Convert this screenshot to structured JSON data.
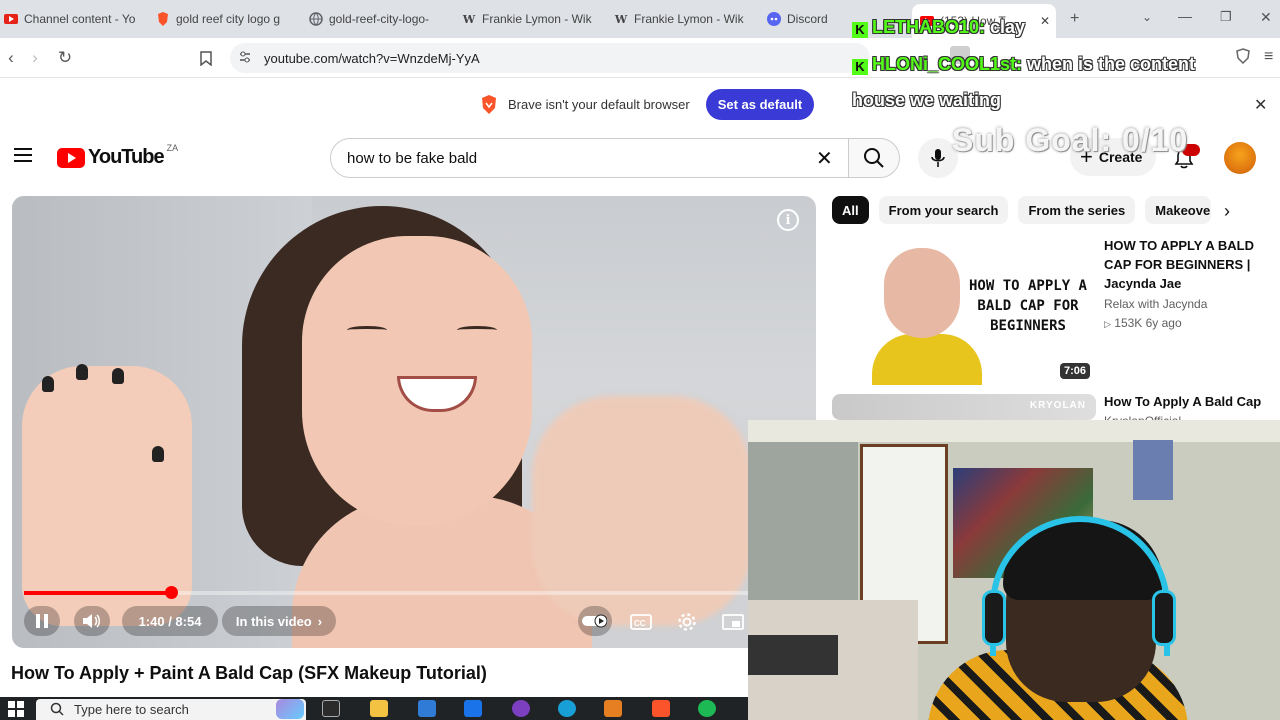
{
  "browser": {
    "tabs": [
      {
        "label": "Channel content - Yo",
        "icon": "youtube-studio-icon",
        "color": "#e62117"
      },
      {
        "label": "gold reef city logo g",
        "icon": "brave-icon",
        "color": "#fb542b"
      },
      {
        "label": "gold-reef-city-logo-",
        "icon": "globe-icon",
        "color": "#5f6368"
      },
      {
        "label": "Frankie Lymon - Wik",
        "icon": "wikipedia-icon",
        "color": "#202124"
      },
      {
        "label": "Frankie Lymon - Wik",
        "icon": "wikipedia-icon",
        "color": "#202124"
      },
      {
        "label": "Discord",
        "icon": "discord-icon",
        "color": "#5865f2"
      },
      {
        "label": "(153) How T",
        "icon": "youtube-icon",
        "color": "#ff0000"
      }
    ],
    "url": "youtube.com/watch?v=WnzdeMj-YyA",
    "banner_text": "Brave isn't your default browser",
    "banner_button": "Set as default"
  },
  "youtube": {
    "logo_text": "YouTube",
    "country": "ZA",
    "search_value": "how to be fake bald",
    "create_label": "Create",
    "player": {
      "time": "1:40 / 8:54",
      "progress_fraction": 0.188,
      "chapters_label": "In this video"
    },
    "video_title": "How To Apply + Paint A Bald Cap (SFX Makeup Tutorial)",
    "chips": [
      "All",
      "From your search",
      "From the series",
      "Makeove"
    ],
    "suggestions": [
      {
        "title": "HOW TO APPLY A BALD CAP FOR BEGINNERS | Jacynda Jae",
        "channel": "Relax with Jacynda",
        "stats": "153K   6y ago",
        "duration": "7:06",
        "thumb_text": "HOW TO APPLY A BALD CAP FOR BEGINNERS"
      },
      {
        "title": "How To Apply A Bald Cap",
        "channel": "KryolanOfficial",
        "thumb_text": "KRYOLAN"
      }
    ]
  },
  "stream_overlay": {
    "chat": [
      {
        "user": "LETHABO10:",
        "message": "clay"
      },
      {
        "user": "HLONi_COOL1st:",
        "message": "when is the content"
      },
      {
        "user": "",
        "message": "house we waiting"
      }
    ],
    "sub_goal": "Sub Goal: 0/10"
  },
  "taskbar": {
    "search_placeholder": "Type here to search"
  },
  "colors": {
    "accent_red": "#ff0000",
    "brave_blue": "#3a3ad6",
    "kick_green": "#53fc18"
  }
}
